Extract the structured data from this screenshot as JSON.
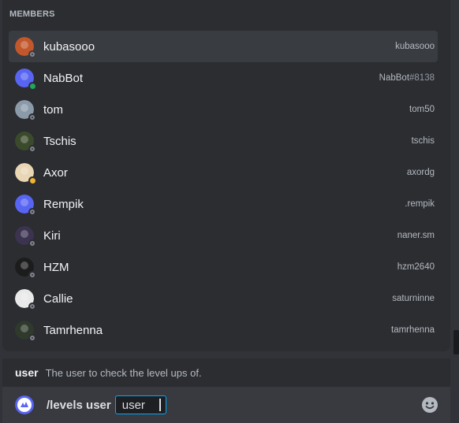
{
  "members_header": "MEMBERS",
  "members": [
    {
      "display": "kubasooo",
      "user": "kubasooo",
      "discrim": "",
      "status": "offline",
      "avatar_color": "#c2572b",
      "selected": true
    },
    {
      "display": "NabBot",
      "user": "NabBot",
      "discrim": "#8138",
      "status": "online",
      "avatar_color": "#5865f2",
      "selected": false
    },
    {
      "display": "tom",
      "user": "tom50",
      "discrim": "",
      "status": "offline",
      "avatar_color": "#8a9aa8",
      "selected": false
    },
    {
      "display": "Tschis",
      "user": "tschis",
      "discrim": "",
      "status": "offline",
      "avatar_color": "#3c4a2c",
      "selected": false
    },
    {
      "display": "Axor",
      "user": "axordg",
      "discrim": "",
      "status": "idle",
      "avatar_color": "#e8d6b4",
      "selected": false
    },
    {
      "display": "Rempik",
      "user": ".rempik",
      "discrim": "",
      "status": "offline",
      "avatar_color": "#5865f2",
      "selected": false
    },
    {
      "display": "Kiri",
      "user": "naner.sm",
      "discrim": "",
      "status": "offline",
      "avatar_color": "#3b3350",
      "selected": false
    },
    {
      "display": "HZM",
      "user": "hzm2640",
      "discrim": "",
      "status": "offline",
      "avatar_color": "#1c1c1c",
      "selected": false
    },
    {
      "display": "Callie",
      "user": "saturninne",
      "discrim": "",
      "status": "offline",
      "avatar_color": "#e9e9e9",
      "selected": false
    },
    {
      "display": "Tamrhenna",
      "user": "tamrhenna",
      "discrim": "",
      "status": "offline",
      "avatar_color": "#2f3a2c",
      "selected": false
    }
  ],
  "hint": {
    "option": "user",
    "description": "The user to check the level ups of."
  },
  "input": {
    "command": "/levels user",
    "option_label": "user"
  },
  "icons": {
    "emoji": "emoji-face-icon",
    "bot_avatar": "nabbot-avatar-icon"
  }
}
